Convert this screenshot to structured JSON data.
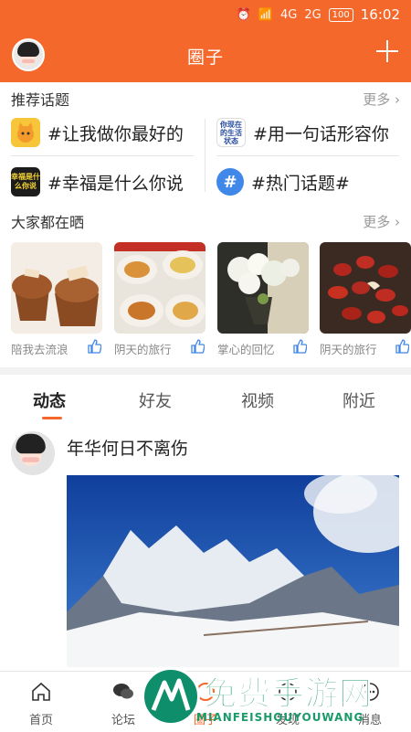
{
  "status": {
    "time": "16:02",
    "battery": "100",
    "signal1": "4G",
    "signal2": "2G"
  },
  "header": {
    "title": "圈子"
  },
  "recommend": {
    "title": "推荐话题",
    "more": "更多",
    "topics": [
      {
        "label": "#让我做你最好的",
        "icon": "cat-icon"
      },
      {
        "label": "#用一句话形容你",
        "icon": "text-card-icon",
        "icon_text": "你现在的生活状态"
      },
      {
        "label": "#幸福是什么你说",
        "icon": "happiness-card-icon",
        "icon_text": "幸福是什么你说"
      },
      {
        "label": "#热门话题#",
        "icon": "hashtag-icon",
        "icon_text": "#"
      }
    ]
  },
  "sharing": {
    "title": "大家都在晒",
    "more": "更多",
    "items": [
      {
        "label": "陪我去流浪"
      },
      {
        "label": "阴天的旅行"
      },
      {
        "label": "掌心的回忆"
      },
      {
        "label": "阴天的旅行"
      }
    ]
  },
  "tabs": [
    {
      "label": "动态",
      "active": true
    },
    {
      "label": "好友"
    },
    {
      "label": "视频"
    },
    {
      "label": "附近"
    }
  ],
  "post": {
    "author": "年华何日不离伤"
  },
  "bottom_nav": [
    {
      "label": "首页",
      "icon": "home-icon"
    },
    {
      "label": "论坛",
      "icon": "chat-icon"
    },
    {
      "label": "圈子",
      "icon": "circle-icon",
      "active": true
    },
    {
      "label": "发现",
      "icon": "compass-icon"
    },
    {
      "label": "消息",
      "icon": "message-icon"
    }
  ],
  "watermark": {
    "cn": "免费手游网",
    "en": "MIANFEISHOUYOUWANG"
  },
  "colors": {
    "accent": "#f5682b"
  }
}
